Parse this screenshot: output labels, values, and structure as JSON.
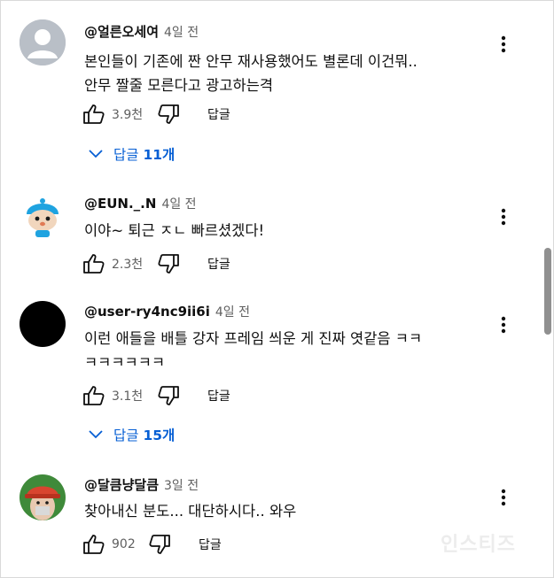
{
  "comments": [
    {
      "author": "@얼른오세여",
      "time": "4일 전",
      "lines": [
        "본인들이 기존에 짠 안무 재사용했어도 별론데 이건뭐..",
        "안무 짤줄 모른다고 광고하는격"
      ],
      "likes": "3.9천",
      "reply_label": "답글",
      "replies_label": "답글",
      "replies_count": "11개"
    },
    {
      "author": "@EUN._.N",
      "time": "4일 전",
      "lines": [
        "이야~ 퇴근 ㅈㄴ 빠르셨겠다!"
      ],
      "likes": "2.3천",
      "reply_label": "답글"
    },
    {
      "author": "@user-ry4nc9ii6i",
      "time": "4일 전",
      "lines": [
        "이런 애들을 배틀 강자 프레임 씌운 게 진짜 엿같음 ㅋㅋ",
        "ㅋㅋㅋㅋㅋㅋ"
      ],
      "likes": "3.1천",
      "reply_label": "답글",
      "replies_label": "답글",
      "replies_count": "15개"
    },
    {
      "author": "@달큼냥달큼",
      "time": "3일 전",
      "lines": [
        "찾아내신 분도... 대단하시다.. 와우"
      ],
      "likes": "902",
      "reply_label": "답글"
    }
  ],
  "watermark": "인스티즈",
  "colors": {
    "link": "#065fd4",
    "meta": "#606060",
    "text": "#0f0f0f"
  },
  "icons": [
    "like-icon",
    "dislike-icon",
    "more-vert-icon",
    "chevron-down-icon"
  ]
}
